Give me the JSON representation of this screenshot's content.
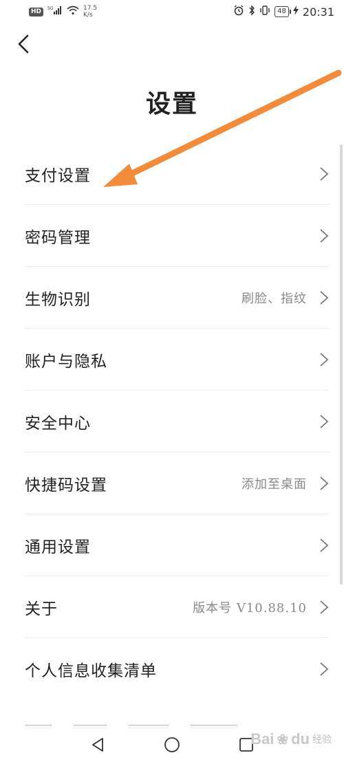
{
  "status_bar": {
    "hd": "HD",
    "signal_label": "5G",
    "net_speed_value": "17.5",
    "net_speed_unit": "K/s",
    "battery": "48",
    "time": "20:31"
  },
  "header": {
    "title": "设置"
  },
  "settings": {
    "items": [
      {
        "label": "支付设置",
        "value": ""
      },
      {
        "label": "密码管理",
        "value": ""
      },
      {
        "label": "生物识别",
        "value": "刷脸、指纹"
      },
      {
        "label": "账户与隐私",
        "value": ""
      },
      {
        "label": "安全中心",
        "value": ""
      },
      {
        "label": "快捷码设置",
        "value": "添加至桌面"
      },
      {
        "label": "通用设置",
        "value": ""
      },
      {
        "label": "关于",
        "value": "版本号 V10.88.10"
      },
      {
        "label": "个人信息收集清单",
        "value": ""
      }
    ]
  },
  "watermark": {
    "brand": "Bai",
    "brand_suffix": "du",
    "sub": "经验"
  },
  "colors": {
    "arrow": "#F28C3A",
    "text_primary": "#222222",
    "text_secondary": "#8A8A8A",
    "divider": "#ECECEC"
  },
  "icons": {
    "back": "chevron-left-icon",
    "chevron": "chevron-right-icon",
    "nav_back": "triangle-back-icon",
    "nav_home": "circle-home-icon",
    "nav_recent": "square-recent-icon"
  }
}
